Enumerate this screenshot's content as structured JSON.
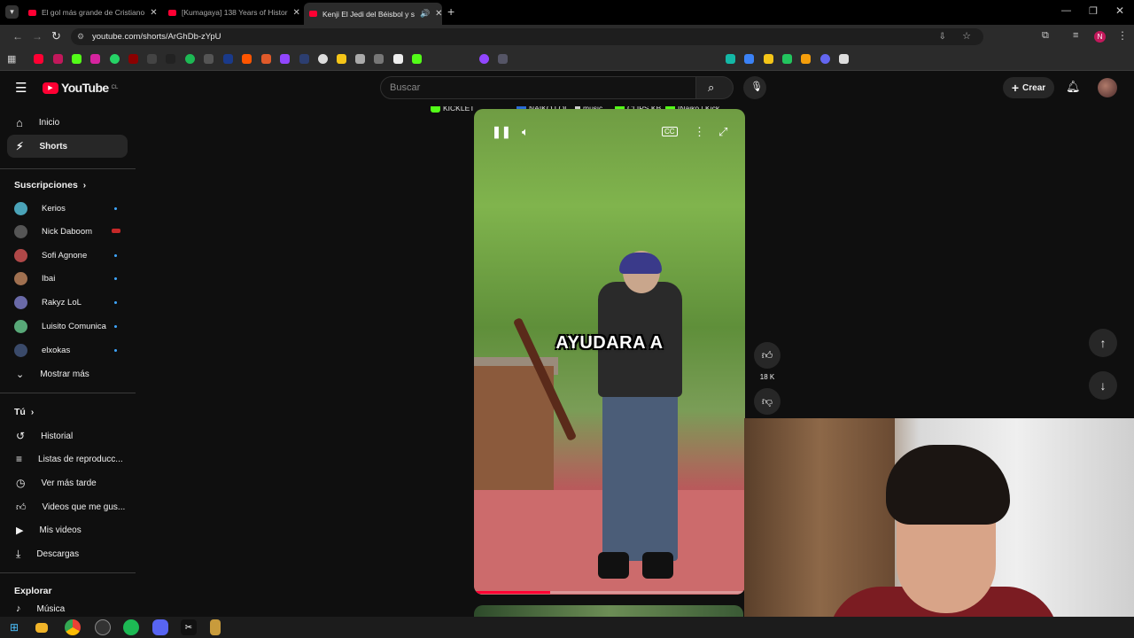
{
  "browser": {
    "tabs": [
      {
        "title": "El gol más grande de Cristiano",
        "active": false
      },
      {
        "title": "[Kumagaya] 138 Years of Histor",
        "active": false
      },
      {
        "title": "Kenji El Jedi del Béisbol y s",
        "active": true
      }
    ],
    "new_tab_glyph": "+",
    "url": "youtube.com/shorts/ArGhDb-zYpU",
    "bookmarks": [
      {
        "label": "KICKLET",
        "color": "#53fc18"
      },
      {
        "label": "NAIKO LOL",
        "color": "#2a6bd6"
      },
      {
        "label": "music",
        "color": "#cccccc"
      },
      {
        "label": "CLIPS KB",
        "color": "#53fc18"
      },
      {
        "label": "INaiko | Kick",
        "color": "#53fc18"
      }
    ],
    "profile_initial": "N"
  },
  "youtube": {
    "logo_text": "YouTube",
    "region": "CL",
    "search_placeholder": "Buscar",
    "create_label": "Crear",
    "accent": "#ff0033"
  },
  "sidebar": {
    "nav": [
      {
        "label": "Inicio",
        "icon": "home-icon",
        "selected": false
      },
      {
        "label": "Shorts",
        "icon": "shorts-icon",
        "selected": true
      }
    ],
    "subscriptions_title": "Suscripciones",
    "subscriptions": [
      {
        "name": "Kerios",
        "color": "#4aa3b8"
      },
      {
        "name": "Nick Daboom",
        "color": "#555555"
      },
      {
        "name": "Sofi Agnone",
        "color": "#b04848"
      },
      {
        "name": "Ibai",
        "color": "#a07050"
      },
      {
        "name": "Rakyz LoL",
        "color": "#6a6aa8"
      },
      {
        "name": "Luisito Comunica",
        "color": "#58a878"
      },
      {
        "name": "elxokas",
        "color": "#3a4a6a"
      }
    ],
    "show_more": "Mostrar más",
    "you_title": "Tú",
    "you_items": [
      {
        "label": "Historial",
        "icon": "history-icon"
      },
      {
        "label": "Listas de reproducc...",
        "icon": "playlist-icon"
      },
      {
        "label": "Ver más tarde",
        "icon": "clock-icon"
      },
      {
        "label": "Videos que me gus...",
        "icon": "thumbs-up-icon"
      },
      {
        "label": "Mis videos",
        "icon": "my-videos-icon"
      },
      {
        "label": "Descargas",
        "icon": "download-icon"
      }
    ],
    "explore_title": "Explorar",
    "explore_items": [
      {
        "label": "Música",
        "icon": "music-icon"
      }
    ]
  },
  "short": {
    "caption": "AYUDARA A",
    "like_count": "18 K",
    "progress": 0.28
  }
}
